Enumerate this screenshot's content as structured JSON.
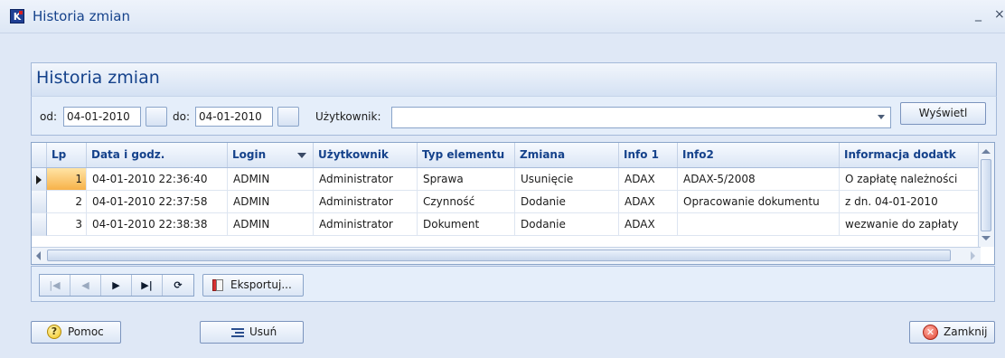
{
  "window": {
    "title": "Historia zmian",
    "minimize_glyph": "_",
    "close_glyph": "×",
    "logo_letter": "K"
  },
  "panel": {
    "title": "Historia zmian"
  },
  "filters": {
    "from_label": "od:",
    "from_value": "04-01-2010",
    "to_label": "do:",
    "to_value": "04-01-2010",
    "user_label": "Użytkownik:",
    "user_value": "",
    "show_button": "Wyświetl"
  },
  "grid": {
    "columns": [
      "Lp",
      "Data i godz.",
      "Login",
      "Użytkownik",
      "Typ elementu",
      "Zmiana",
      "Info 1",
      "Info2",
      "Informacja dodatk"
    ],
    "sorted_column": "Login",
    "rows": [
      {
        "lp": "1",
        "datetime": "04-01-2010 22:36:40",
        "login": "ADMIN",
        "user": "Administrator",
        "type": "Sprawa",
        "change": "Usunięcie",
        "info1": "ADAX",
        "info2": "ADAX-5/2008",
        "extra": "O zapłatę należności",
        "current": true
      },
      {
        "lp": "2",
        "datetime": "04-01-2010 22:37:58",
        "login": "ADMIN",
        "user": "Administrator",
        "type": "Czynność",
        "change": "Dodanie",
        "info1": "ADAX",
        "info2": "Opracowanie dokumentu",
        "extra": "z dn. 04-01-2010",
        "current": false
      },
      {
        "lp": "3",
        "datetime": "04-01-2010 22:38:38",
        "login": "ADMIN",
        "user": "Administrator",
        "type": "Dokument",
        "change": "Dodanie",
        "info1": "ADAX",
        "info2": "",
        "extra": "wezwanie do zapłaty",
        "current": false
      }
    ]
  },
  "navigator": {
    "first": "|◀",
    "prev": "◀",
    "next": "▶",
    "last": "▶|",
    "refresh": "⟳",
    "export_button": "Eksportuj..."
  },
  "buttons": {
    "help": "Pomoc",
    "help_icon": "?",
    "delete": "Usuń",
    "close": "Zamknij",
    "close_icon": "✕"
  }
}
